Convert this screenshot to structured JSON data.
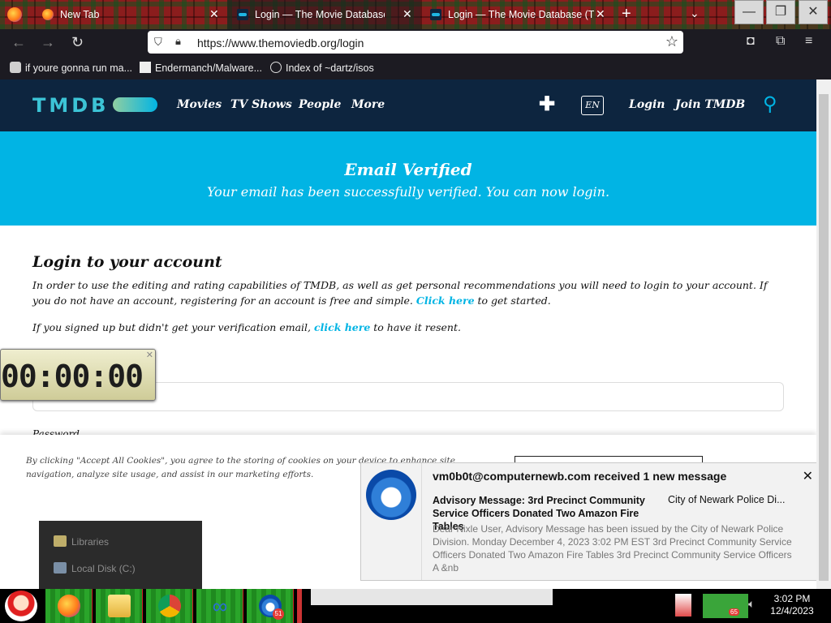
{
  "browser": {
    "tabs": [
      {
        "title": "New Tab",
        "icon": "firefox-icon",
        "active": false
      },
      {
        "title": "Login — The Movie Database (TM",
        "icon": "tmdb-icon",
        "active": true
      },
      {
        "title": "Login — The Movie Database (TM",
        "icon": "tmdb-icon",
        "active": false
      }
    ],
    "new_tab_glyph": "+",
    "url": "https://www.themoviedb.org/login",
    "bookmarks": [
      {
        "label": "if youre gonna run ma...",
        "icon": "ghost-icon"
      },
      {
        "label": "Endermanch/Malware...",
        "icon": "github-icon"
      },
      {
        "label": "Index of ~dartz/isos",
        "icon": "globe-icon"
      }
    ]
  },
  "tmdb": {
    "logo_text": "TMDB",
    "nav": [
      "Movies",
      "TV Shows",
      "People",
      "More"
    ],
    "lang": "EN",
    "login": "Login",
    "join": "Join TMDB",
    "banner_title": "Email Verified",
    "banner_subtitle": "Your email has been successfully verified. You can now login.",
    "heading": "Login to your account",
    "para1_text": "In order to use the editing and rating capabilities of TMDB, as well as get personal recommendations you will need to login to your account. If you do not have an account, registering for an account is free and simple.",
    "para1_link": "Click here",
    "para1_end": "to get started.",
    "para2_text": "If you signed up but didn't get your verification email,",
    "para2_link": "click here",
    "para2_end": "to have it resent.",
    "password_label": "Password",
    "cookie_text": "By clicking \"Accept All Cookies\", you agree to the storing of cookies on your device to enhance site navigation, analyze site usage, and assist in our marketing efforts."
  },
  "clock_widget": {
    "time": "00:00:00"
  },
  "explorer_menu": [
    "Libraries",
    "Local Disk (C:)"
  ],
  "notification": {
    "header": "vm0b0t@computernewb.com received 1 new message",
    "subject": "Advisory Message: 3rd Precinct Community Service Officers Donated Two Amazon Fire Tables",
    "from": "City of Newark Police Di...",
    "body": "Dear Nixle User, Advisory Message has been issued by the City of Newark Police Division. Monday December 4, 2023 3:02 PM EST 3rd Precinct Community Service Officers Donated Two Amazon Fire Tables 3rd Precinct Community Service Officers A &nb"
  },
  "taskbar": {
    "apps": [
      "firefox-icon",
      "file-explorer-icon",
      "chrome-icon",
      "infinity-icon",
      "thunderbird-icon"
    ],
    "thunderbird_badge": "51",
    "tray_badge": "65",
    "time": "3:02 PM",
    "date": "12/4/2023"
  },
  "colors": {
    "tmdb_navy": "#0d253f",
    "tmdb_blue": "#01b4e4",
    "tmdb_teal": "#3cc4d6"
  }
}
